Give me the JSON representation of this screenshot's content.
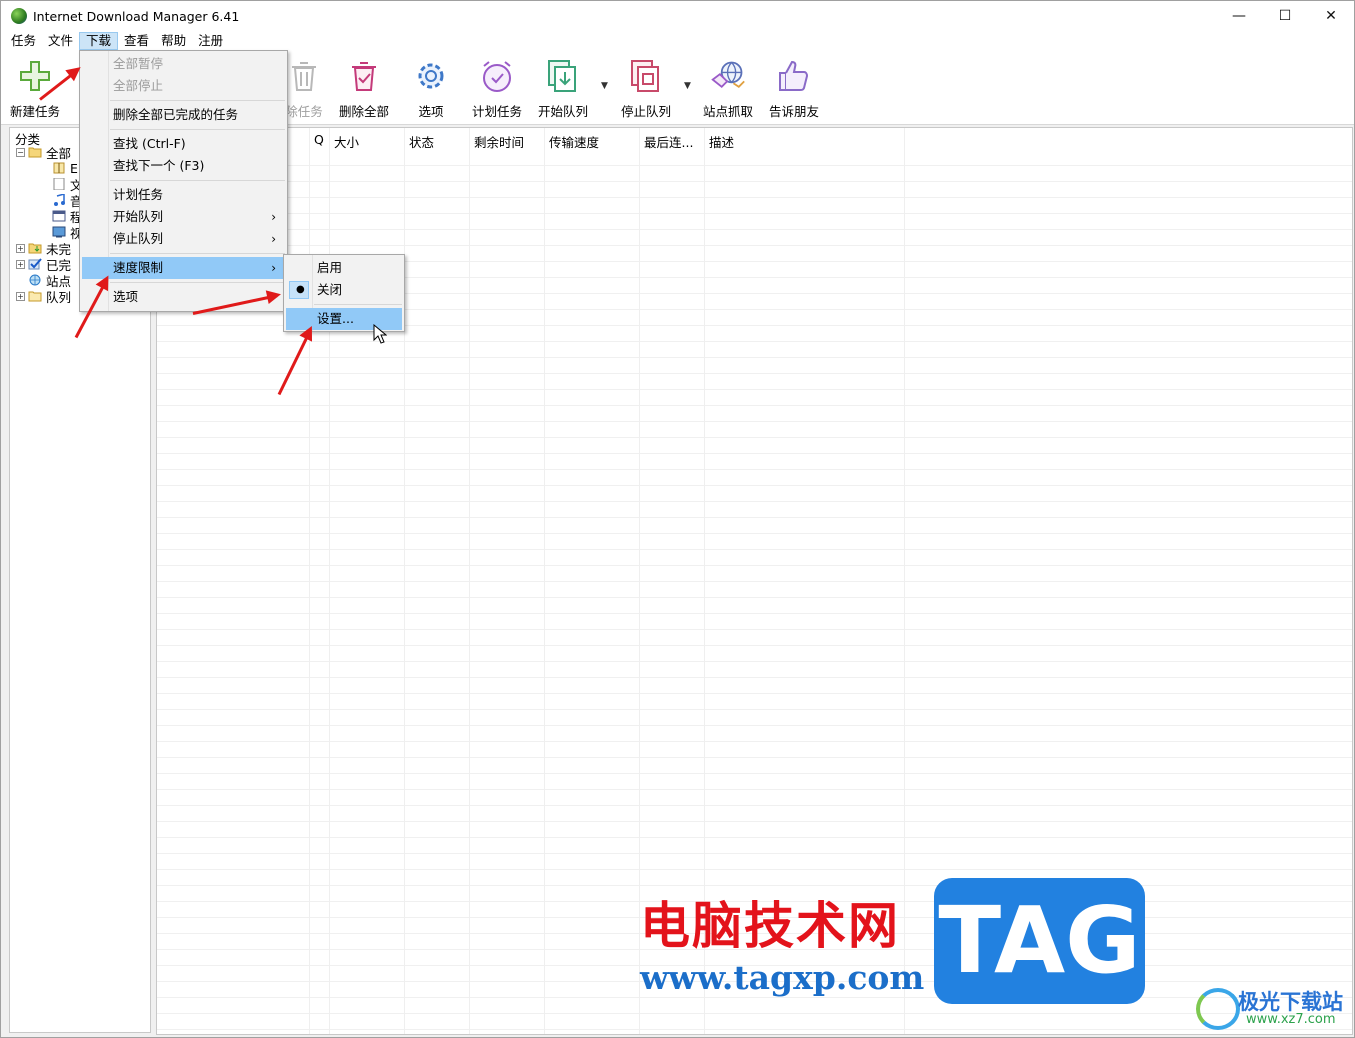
{
  "window": {
    "title": "Internet Download Manager 6.41",
    "minimize": "—",
    "maximize": "☐",
    "close": "✕"
  },
  "menubar": {
    "items": [
      "任务",
      "文件",
      "下载",
      "查看",
      "帮助",
      "注册"
    ]
  },
  "toolbar": {
    "new_task": "新建任务",
    "delete_task": "除任务",
    "delete_all": "删除全部",
    "options": "选项",
    "scheduler": "计划任务",
    "start_queue": "开始队列",
    "stop_queue": "停止队列",
    "site_grabber": "站点抓取",
    "tell_friend": "告诉朋友"
  },
  "sidebar": {
    "title": "分类",
    "items": [
      "全部",
      "E",
      "文",
      "音",
      "程",
      "视",
      "未完",
      "已完",
      "站点",
      "队列"
    ]
  },
  "list": {
    "columns": [
      "Q",
      "大小",
      "状态",
      "剩余时间",
      "传输速度",
      "最后连...",
      "描述"
    ]
  },
  "download_menu": {
    "pause_all": "全部暂停",
    "stop_all": "全部停止",
    "delete_completed": "删除全部已完成的任务",
    "find": "查找 (Ctrl-F)",
    "find_next": "查找下一个 (F3)",
    "scheduler": "计划任务",
    "start_queue": "开始队列",
    "stop_queue": "停止队列",
    "speed_limiter": "速度限制",
    "options": "选项",
    "arrow": "›"
  },
  "speed_submenu": {
    "enable": "启用",
    "disable": "关闭",
    "settings": "设置...",
    "bullet": "●"
  },
  "watermark": {
    "cn": "电脑技术网",
    "url": "www.tagxp.com",
    "tag": "TAG",
    "site2": "极光下载站",
    "site2_url": "www.xz7.com"
  }
}
